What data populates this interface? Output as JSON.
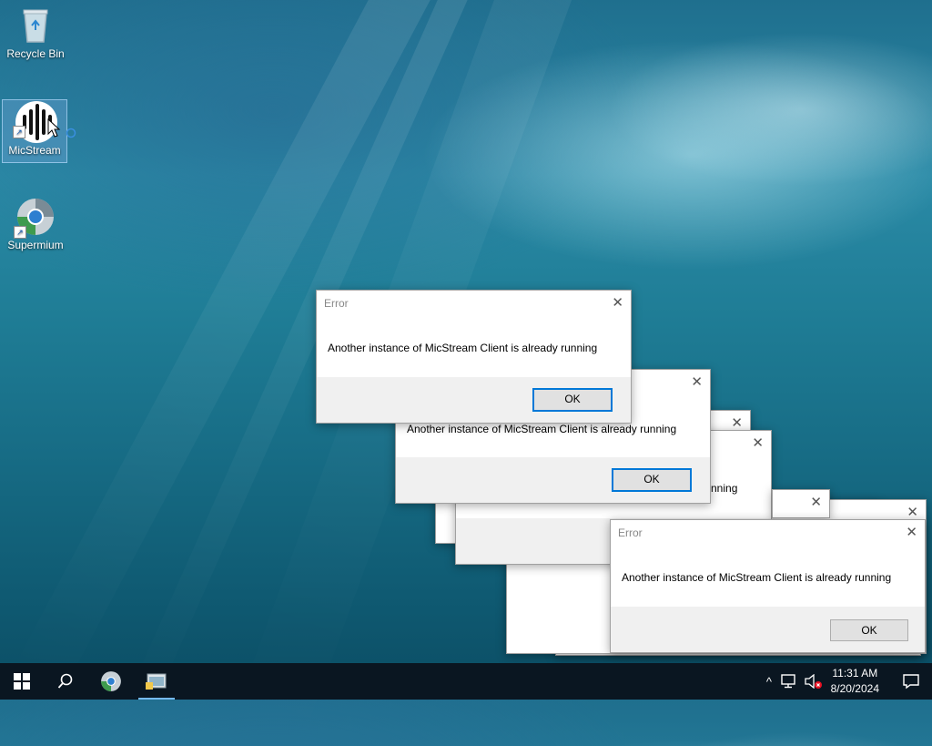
{
  "desktop": {
    "icons": [
      {
        "label": "Recycle Bin",
        "icon": "recycle-bin-icon"
      },
      {
        "label": "MicStream",
        "icon": "micstream-icon"
      },
      {
        "label": "Supermium",
        "icon": "supermium-icon"
      }
    ]
  },
  "dialogs": [
    {
      "title": "Error",
      "message": "Another instance of MicStream Client is already running",
      "ok_label": "OK",
      "close_glyph": "✕"
    },
    {
      "title": "",
      "message": "Another instance of MicStream Client is already running",
      "ok_label": "OK",
      "close_glyph": "✕"
    },
    {
      "title": "",
      "message": "nning",
      "ok_label": "",
      "close_glyph": "✕"
    },
    {
      "title": "Error",
      "message": "Another instance of MicStream Client is already running",
      "ok_label": "OK",
      "close_glyph": "✕"
    }
  ],
  "taskbar": {
    "start_icon": "windows-start-icon",
    "search_icon": "search-icon",
    "pinned": [
      "supermium-icon",
      "file-explorer-icon"
    ],
    "tray": {
      "chevron": "^",
      "time": "11:31 AM",
      "date": "8/20/2024"
    }
  }
}
